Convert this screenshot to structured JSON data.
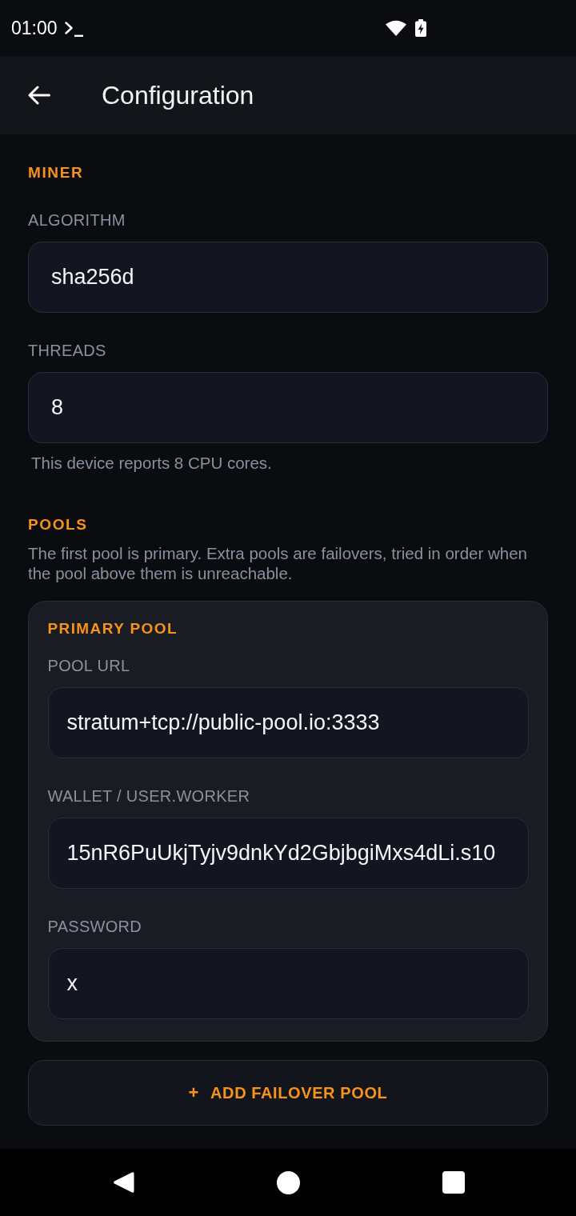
{
  "status_bar": {
    "time": "01:00"
  },
  "app_bar": {
    "title": "Configuration"
  },
  "miner": {
    "heading": "MINER",
    "fields": [
      {
        "label": "ALGORITHM",
        "value": "sha256d"
      },
      {
        "label": "THREADS",
        "value": "8",
        "helper": "This device reports 8 CPU cores."
      }
    ]
  },
  "pools": {
    "heading": "POOLS",
    "description": "The first pool is primary. Extra pools are failovers, tried in order when the pool above them is unreachable.",
    "cards": [
      {
        "title": "PRIMARY POOL",
        "fields": [
          {
            "label": "POOL URL",
            "value": "stratum+tcp://public-pool.io:3333"
          },
          {
            "label": "WALLET / USER.WORKER",
            "value": "15nR6PuUkjTyjv9dnkYd2GbjbgiMxs4dLi.s10"
          },
          {
            "label": "PASSWORD",
            "value": "x"
          }
        ]
      }
    ],
    "add_button": {
      "glyph": "+",
      "label": "ADD FAILOVER POOL"
    }
  }
}
